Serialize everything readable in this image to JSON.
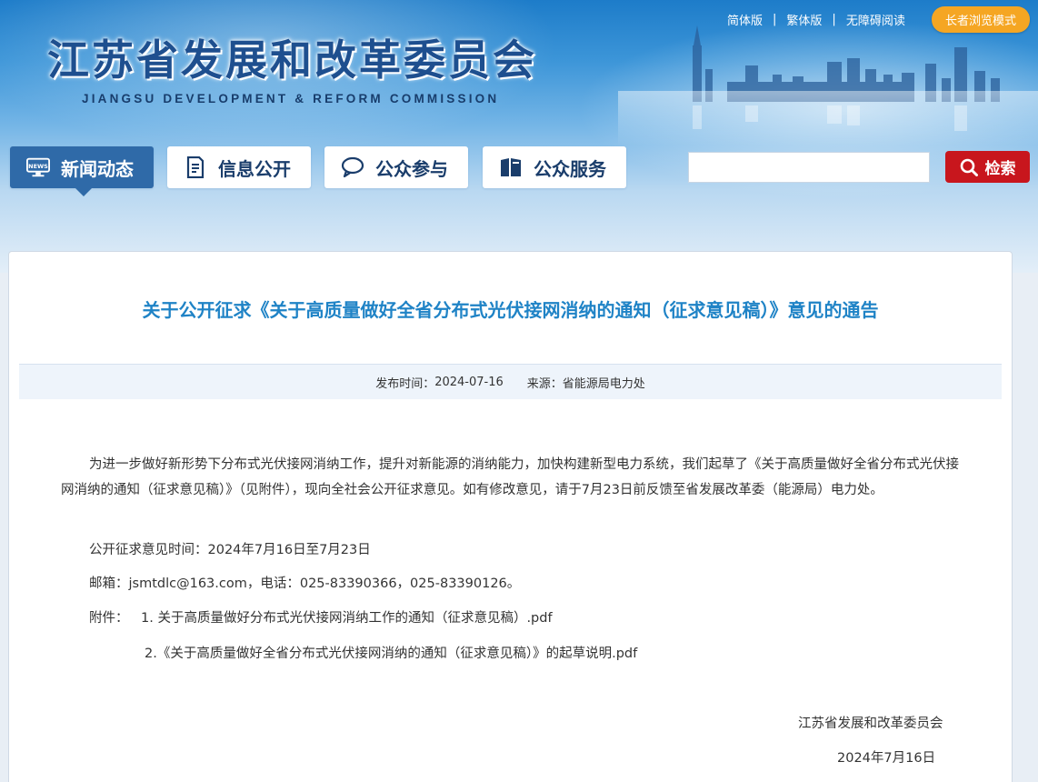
{
  "header": {
    "site_title": "江苏省发展和改革委员会",
    "site_subtitle": "JIANGSU DEVELOPMENT & REFORM COMMISSION",
    "top_links": [
      "简体版",
      "繁体版",
      "无障碍阅读"
    ],
    "separator": "|",
    "elder_mode_label": "长者浏览模式"
  },
  "nav": {
    "items": [
      {
        "label": "新闻动态",
        "icon": "news-icon",
        "active": true
      },
      {
        "label": "信息公开",
        "icon": "document-icon",
        "active": false
      },
      {
        "label": "公众参与",
        "icon": "chat-icon",
        "active": false
      },
      {
        "label": "公众服务",
        "icon": "book-icon",
        "active": false
      }
    ],
    "search_placeholder": "",
    "search_label": "检索"
  },
  "article": {
    "title": "关于公开征求《关于高质量做好全省分布式光伏接网消纳的通知（征求意见稿）》意见的通告",
    "publish_label": "发布时间：",
    "publish_date": "2024-07-16",
    "source_label": "来源：",
    "source": "省能源局电力处",
    "paragraph": "为进一步做好新形势下分布式光伏接网消纳工作，提升对新能源的消纳能力，加快构建新型电力系统，我们起草了《关于高质量做好全省分布式光伏接网消纳的通知（征求意见稿）》（见附件），现向全社会公开征求意见。如有修改意见，请于7月23日前反馈至省发展改革委（能源局）电力处。",
    "period": "公开征求意见时间：2024年7月16日至7月23日",
    "contact": "邮箱：jsmtdlc@163.com，电话：025-83390366，025-83390126。",
    "attachments_label": "附件：",
    "attachments": [
      "1. 关于高质量做好分布式光伏接网消纳工作的通知（征求意见稿）.pdf",
      "2.《关于高质量做好全省分布式光伏接网消纳的通知（征求意见稿）》的起草说明.pdf"
    ],
    "signature": "江苏省发展和改革委员会",
    "sign_date": "2024年7月16日"
  },
  "colors": {
    "title_blue": "#1f83c6",
    "nav_active": "#2f6aa8",
    "search_red": "#c8161d",
    "elder_orange": "#f5a623"
  }
}
